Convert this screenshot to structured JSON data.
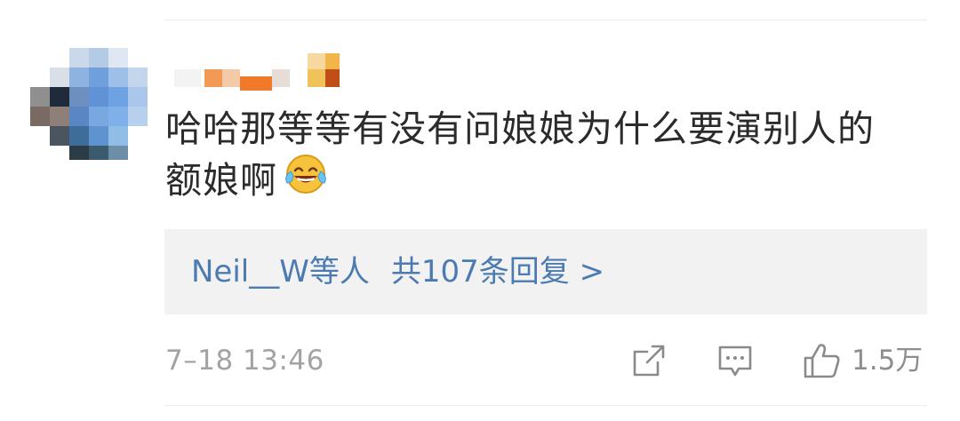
{
  "comment": {
    "text_line1": "哈哈那等等有没有问娘娘为什么要演别人的",
    "text_line2": "额娘啊",
    "emoji": "laughing-tears-emoji"
  },
  "replies": {
    "users": "Neil__W等人",
    "count_text": "共107条回复 >"
  },
  "footer": {
    "timestamp": "7–18 13:46",
    "like_count": "1.5万"
  },
  "colors": {
    "link": "#4c7bb1",
    "reply_bg": "#f2f2f2",
    "meta_text": "#a3a3a3"
  },
  "icons": [
    "share-icon",
    "comment-icon",
    "like-icon"
  ]
}
